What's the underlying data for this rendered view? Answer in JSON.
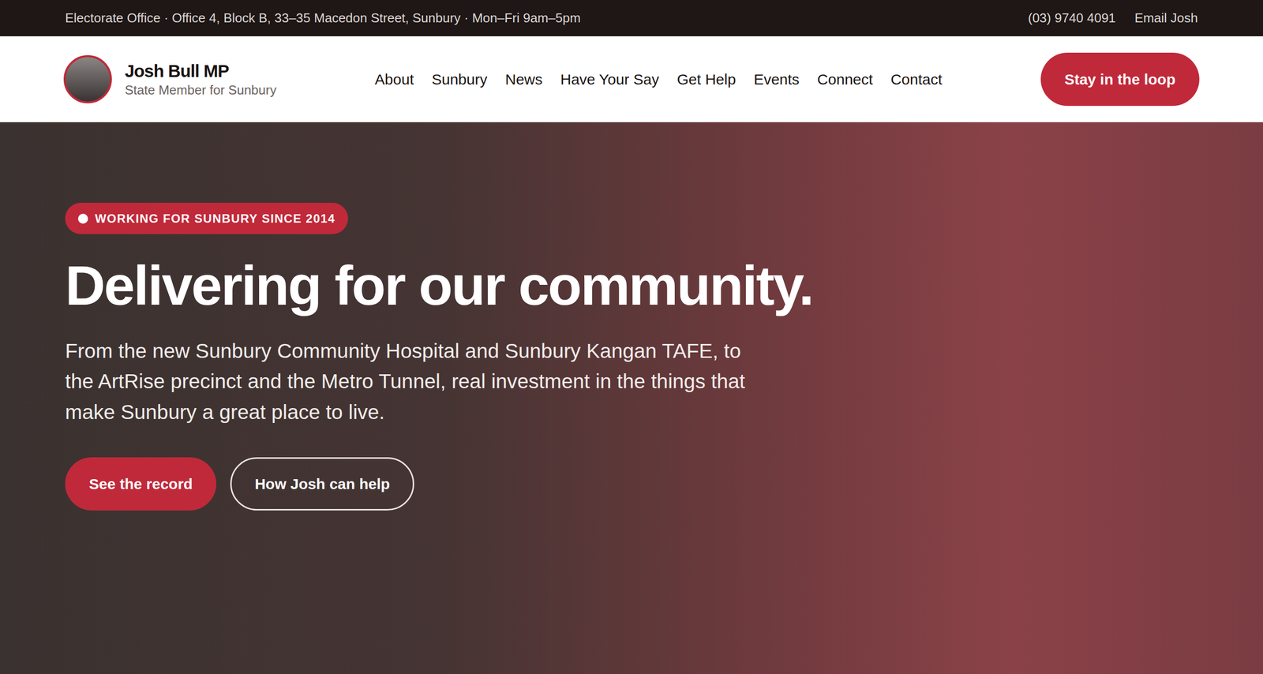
{
  "top_bar": {
    "address": "Electorate Office · Office 4, Block B, 33–35 Macedon Street, Sunbury · Mon–Fri 9am–5pm",
    "phone": "(03) 9740 4091",
    "email": "Email Josh"
  },
  "brand": {
    "name": "Josh Bull MP",
    "subtitle": "State Member for Sunbury"
  },
  "nav": [
    {
      "label": "About",
      "selected": false
    },
    {
      "label": "Sunbury",
      "selected": false
    },
    {
      "label": "News",
      "selected": false
    },
    {
      "label": "Have Your Say",
      "selected": false
    },
    {
      "label": "Get Help",
      "selected": false
    },
    {
      "label": "Events",
      "selected": false
    },
    {
      "label": "Connect",
      "selected": false
    },
    {
      "label": "Contact",
      "selected": false
    }
  ],
  "cta": "Stay in the loop",
  "hero": {
    "badge": "WORKING FOR SUNBURY SINCE 2014",
    "heading": "Delivering for our community.",
    "text": "From the new Sunbury Community Hospital and Sunbury Kangan TAFE, to the ArtRise precinct and the Metro Tunnel, real investment in the things that make Sunbury a great place to live.",
    "buttons": [
      {
        "label": "See the record",
        "kind": "primary"
      },
      {
        "label": "How Josh can help",
        "kind": "outline"
      }
    ]
  }
}
